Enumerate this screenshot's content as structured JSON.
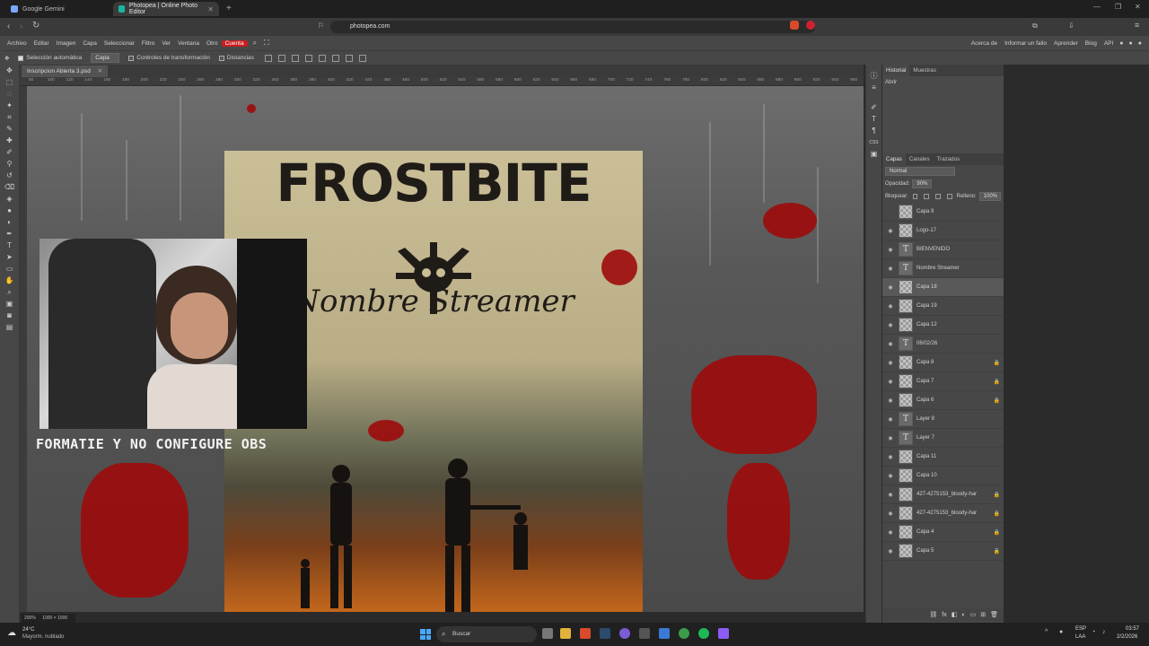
{
  "browser": {
    "tabs": [
      {
        "label": "Google Gemini"
      },
      {
        "label": "Photopea | Online Photo Editor"
      }
    ],
    "url": "photopea.com"
  },
  "menu": {
    "items": [
      "Archivo",
      "Editar",
      "Imagen",
      "Capa",
      "Seleccionar",
      "Filtro",
      "Ver",
      "Ventana",
      "Otro",
      "Cuenta"
    ],
    "right_items": [
      "Acerca de",
      "Informar un fallo",
      "Aprender",
      "Blog",
      "API"
    ]
  },
  "options": {
    "auto_select": "Selección automática",
    "layer_select": "Capa",
    "transform_controls": "Controles de transformación",
    "distances": "Distancias"
  },
  "document": {
    "tab_label": "Inscripcion Abierta 3.psd",
    "zoom": "200%",
    "size": "1000 × 1000"
  },
  "ruler": {
    "ticks": [
      "80",
      "100",
      "120",
      "140",
      "160",
      "180",
      "200",
      "220",
      "240",
      "260",
      "280",
      "300",
      "320",
      "340",
      "360",
      "380",
      "400",
      "420",
      "440",
      "460",
      "480",
      "500",
      "520",
      "540",
      "560",
      "580",
      "600",
      "620",
      "640",
      "660",
      "680",
      "700",
      "720",
      "740",
      "760",
      "780",
      "800",
      "820",
      "840",
      "860",
      "880",
      "900",
      "920",
      "940",
      "960"
    ]
  },
  "canvas": {
    "poster_title": "FROSTBITE",
    "poster_subtitle": "Nombre Streamer",
    "overlay_caption": "FORMATIE Y NO CONFIGURE OBS"
  },
  "history_panel": {
    "tabs": [
      "Historial",
      "Muestras"
    ],
    "entry": "Abrir"
  },
  "layers_panel": {
    "tabs": [
      "Capas",
      "Canales",
      "Trazados"
    ],
    "blend_mode": "Normal",
    "opacity_label": "Opacidad:",
    "opacity_value": "90%",
    "lock_label": "Bloquear:",
    "fill_label": "Relleno:",
    "fill_value": "100%",
    "layers": [
      {
        "name": "Capa 9",
        "type": "raster",
        "visible": false
      },
      {
        "name": "Logo-17",
        "type": "raster",
        "visible": true
      },
      {
        "name": "BIENVENIDO",
        "type": "text",
        "visible": true
      },
      {
        "name": "Nombre Streamer",
        "type": "text",
        "visible": true
      },
      {
        "name": "Capa 18",
        "type": "raster",
        "visible": true,
        "selected": true
      },
      {
        "name": "Capa 19",
        "type": "raster",
        "visible": true
      },
      {
        "name": "Capa 12",
        "type": "raster",
        "visible": true
      },
      {
        "name": "06/02/26",
        "type": "text",
        "visible": true
      },
      {
        "name": "Capa 8",
        "type": "raster",
        "visible": true,
        "locked": true
      },
      {
        "name": "Capa 7",
        "type": "raster",
        "visible": true,
        "locked": true
      },
      {
        "name": "Capa 6",
        "type": "raster",
        "visible": true,
        "locked": true
      },
      {
        "name": "Layer 8",
        "type": "text",
        "visible": true
      },
      {
        "name": "Layer 7",
        "type": "text",
        "visible": true
      },
      {
        "name": "Capa 11",
        "type": "raster",
        "visible": true
      },
      {
        "name": "Capa 10",
        "type": "raster",
        "visible": true
      },
      {
        "name": "427-4275153_bloody-har",
        "type": "raster",
        "visible": true,
        "locked": true
      },
      {
        "name": "427-4275153_bloody-har",
        "type": "raster",
        "visible": true,
        "locked": true
      },
      {
        "name": "Capa 4",
        "type": "raster",
        "visible": true,
        "locked": true
      },
      {
        "name": "Capa 5",
        "type": "raster",
        "visible": true,
        "locked": true
      }
    ]
  },
  "taskbar": {
    "weather_temp": "24°C",
    "weather_desc": "Mayorm. nublado",
    "search_placeholder": "Buscar",
    "lang": "ESP",
    "lang_sub": "LAA",
    "time": "03:57",
    "date": "2/2/2026"
  }
}
